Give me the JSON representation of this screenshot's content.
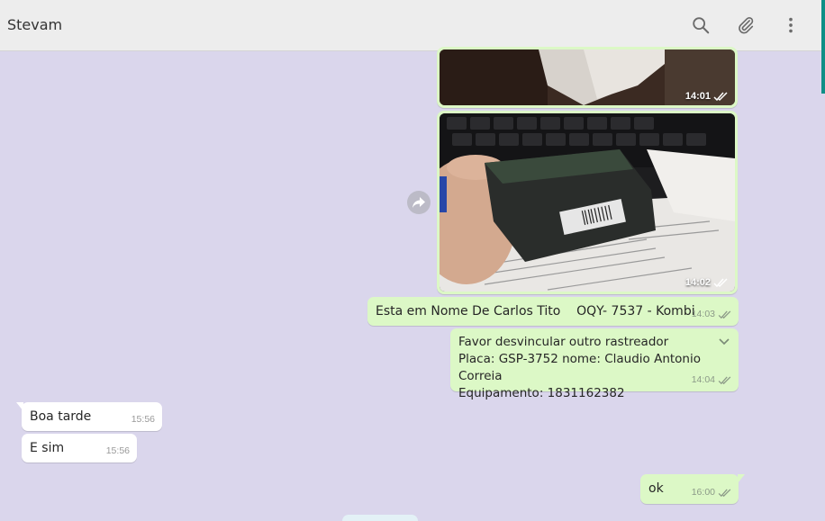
{
  "header": {
    "contact_name": "Stevam",
    "icons": [
      "search-icon",
      "attach-icon",
      "menu-icon"
    ]
  },
  "messages": [
    {
      "type": "image",
      "direction": "out",
      "time": "14:01",
      "status": "read",
      "depiction": "paper and desk"
    },
    {
      "type": "image",
      "direction": "out",
      "time": "14:02",
      "status": "read",
      "depiction": "hand holding tracker device over keyboard and printed page"
    },
    {
      "type": "text",
      "direction": "out",
      "text": "Esta em Nome De Carlos Tito    OQY- 7537 - Kombi",
      "time": "14:03",
      "status": "read"
    },
    {
      "type": "text",
      "direction": "out",
      "lines": [
        "Favor desvincular outro rastreador",
        "Placa: GSP-3752 nome: Claudio Antonio Correia",
        "Equipamento: 1831162382"
      ],
      "time": "14:04",
      "status": "read"
    },
    {
      "type": "text",
      "direction": "in",
      "text": "Boa tarde",
      "time": "15:56"
    },
    {
      "type": "text",
      "direction": "in",
      "text": "E sim",
      "time": "15:56"
    },
    {
      "type": "text",
      "direction": "out",
      "text": "ok",
      "time": "16:00",
      "status": "read"
    }
  ],
  "colors": {
    "chat_background": "#dad6ec",
    "outgoing_bubble": "#dcf8c6",
    "incoming_bubble": "#ffffff",
    "header_background": "#ededed",
    "accent": "#0f8f86"
  }
}
